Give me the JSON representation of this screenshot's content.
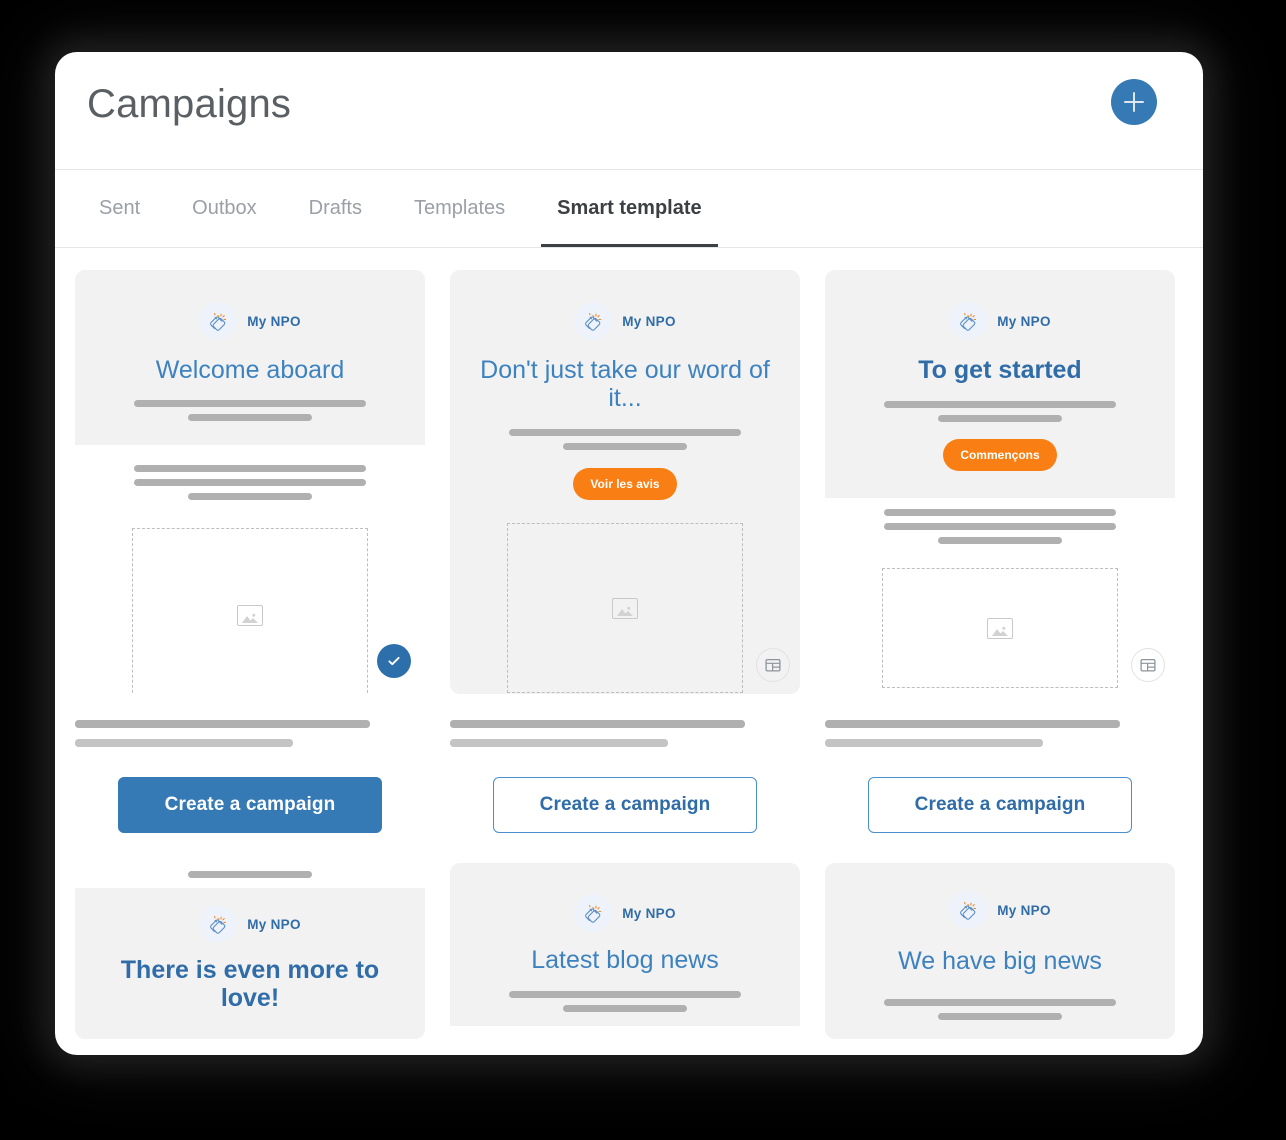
{
  "header": {
    "title": "Campaigns",
    "add_button_label": "+",
    "add_icon": "plus-icon"
  },
  "tabs": [
    {
      "label": "Sent",
      "active": false
    },
    {
      "label": "Outbox",
      "active": false
    },
    {
      "label": "Drafts",
      "active": false
    },
    {
      "label": "Templates",
      "active": false
    },
    {
      "label": "Smart template",
      "active": true
    }
  ],
  "colors": {
    "accent_blue": "#3579b5",
    "title_blue": "#3d82bf",
    "orange": "#f97f14",
    "card_gray": "#f2f2f2",
    "text_gray": "#5a5f63",
    "tab_inactive": "#9aa0a6"
  },
  "icons": {
    "brand_logo": "clapping-hands-icon",
    "image_placeholder": "image-placeholder-icon",
    "selected_badge": "check-icon",
    "layout_badge": "layout-template-icon"
  },
  "brand": {
    "name": "My NPO"
  },
  "cards": [
    {
      "id": "welcome-aboard",
      "headline": "Welcome aboard",
      "headline_bold": false,
      "cta_button": "Create a campaign",
      "cta_style": "filled",
      "badge": "check-icon",
      "selected": true,
      "has_pill": false,
      "pill_label": ""
    },
    {
      "id": "dont-just-take-our-word",
      "headline": "Don't just take our word of it...",
      "headline_bold": false,
      "cta_button": "Create a campaign",
      "cta_style": "outline",
      "badge": "layout-template-icon",
      "selected": false,
      "has_pill": true,
      "pill_label": "Voir les avis"
    },
    {
      "id": "to-get-started",
      "headline": "To get started",
      "headline_bold": true,
      "cta_button": "Create a campaign",
      "cta_style": "outline",
      "badge": "layout-template-icon",
      "selected": false,
      "has_pill": true,
      "pill_label": "Commençons"
    }
  ],
  "cards_row2": [
    {
      "id": "there-is-even-more-to-love",
      "headline": "There is even more to love!",
      "headline_bold": true
    },
    {
      "id": "latest-blog-news",
      "headline": "Latest blog news",
      "headline_bold": false
    },
    {
      "id": "we-have-big-news",
      "headline": "We have big news",
      "headline_bold": false
    }
  ]
}
